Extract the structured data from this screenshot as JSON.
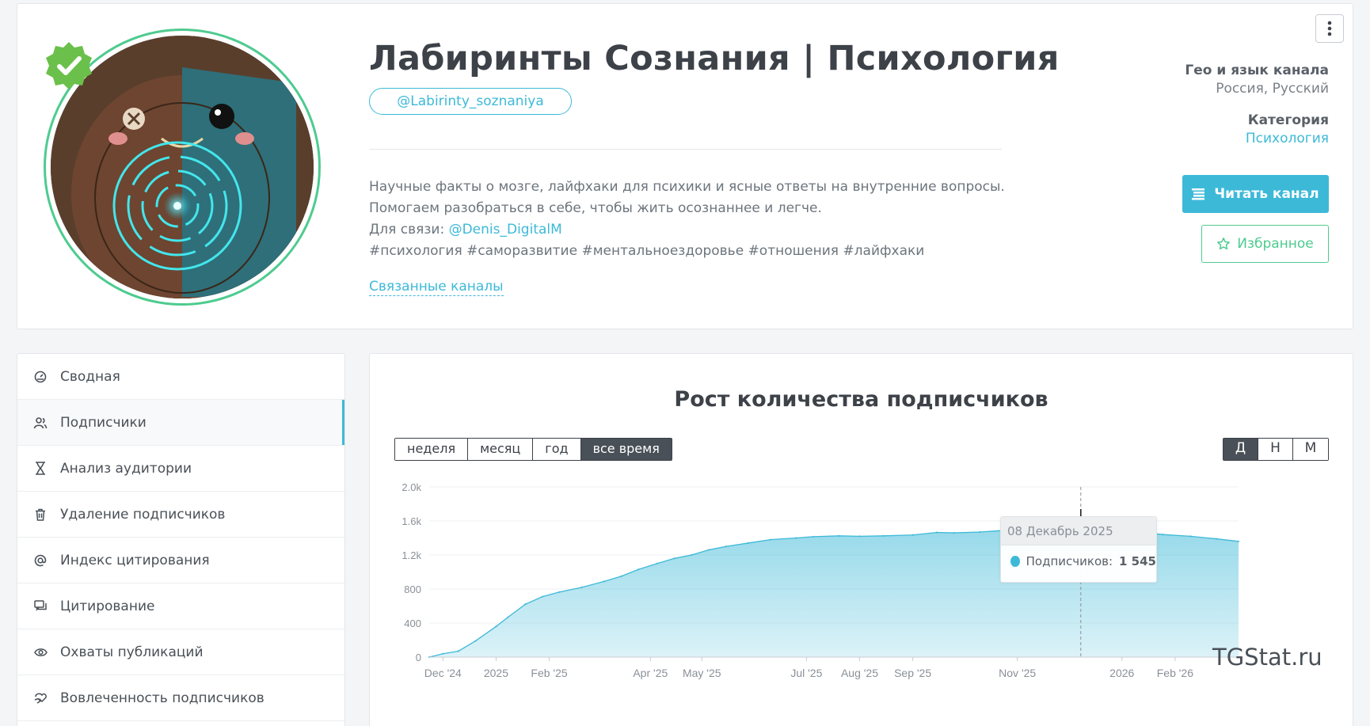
{
  "header": {
    "title": "Лабиринты Сознания | Психология",
    "username": "@Labirinty_soznaniya",
    "description": {
      "line1": "Научные факты о мозге, лайфхаки для психики и ясные ответы на внутренние вопросы.",
      "line2": "Помогаем разобраться в себе, чтобы жить осознаннее и легче.",
      "contact_label": "Для связи:",
      "contact_link": "@Denis_DigitalM",
      "hashtags": "#психология #саморазвитие #ментальноездоровье #отношения #лайфхаки"
    },
    "related_link": "Связанные каналы",
    "geo_label": "Гео и язык канала",
    "geo_value": "Россия, Русский",
    "category_label": "Категория",
    "category_value": "Психология",
    "read_button": "Читать канал",
    "favorite_button": "Избранное",
    "colors": {
      "accent": "#3db9d8",
      "green": "#4ecb8f"
    },
    "icons": [
      "verified-badge-icon",
      "more-vertical-icon",
      "list-icon",
      "star-icon"
    ]
  },
  "sidebar": {
    "items": [
      {
        "label": "Сводная",
        "icon": "dashboard-icon",
        "active": false
      },
      {
        "label": "Подписчики",
        "icon": "users-icon",
        "active": true
      },
      {
        "label": "Анализ аудитории",
        "icon": "hourglass-icon",
        "active": false
      },
      {
        "label": "Удаление подписчиков",
        "icon": "trash-icon",
        "active": false
      },
      {
        "label": "Индекс цитирования",
        "icon": "at-icon",
        "active": false
      },
      {
        "label": "Цитирование",
        "icon": "quote-icon",
        "active": false
      },
      {
        "label": "Охваты публикаций",
        "icon": "eye-icon",
        "active": false
      },
      {
        "label": "Вовлеченность подписчиков",
        "icon": "engagement-icon",
        "active": false
      }
    ]
  },
  "chart_panel": {
    "title": "Рост количества подписчиков",
    "periods": [
      "неделя",
      "месяц",
      "год",
      "все время"
    ],
    "active_period": "все время",
    "resolutions": [
      "Д",
      "Н",
      "М"
    ],
    "active_resolution": "Д",
    "tooltip": {
      "date": "08 Декабрь 2025",
      "label": "Подписчиков:",
      "value": "1 545"
    },
    "watermark": "TGStat.ru"
  },
  "chart_data": {
    "type": "area",
    "title": "Рост количества подписчиков",
    "xlabel": "",
    "ylabel": "",
    "ylim": [
      0,
      2000
    ],
    "y_ticks": [
      0,
      400,
      800,
      1200,
      1600,
      2000
    ],
    "y_tick_labels": [
      "0",
      "400",
      "800",
      "1.2k",
      "1.6k",
      "2.0k"
    ],
    "x_ticks": [
      {
        "date": "2024-12-01",
        "label": "Dec '24"
      },
      {
        "date": "2025-01-01",
        "label": "2025"
      },
      {
        "date": "2025-02-01",
        "label": "Feb '25"
      },
      {
        "date": "2025-04-01",
        "label": "Apr '25"
      },
      {
        "date": "2025-05-01",
        "label": "May '25"
      },
      {
        "date": "2025-07-01",
        "label": "Jul '25"
      },
      {
        "date": "2025-08-01",
        "label": "Aug '25"
      },
      {
        "date": "2025-09-01",
        "label": "Sep '25"
      },
      {
        "date": "2025-11-01",
        "label": "Nov '25"
      },
      {
        "date": "2026-01-01",
        "label": "2026"
      },
      {
        "date": "2026-02-01",
        "label": "Feb '26"
      }
    ],
    "x_range": [
      "2024-11-23",
      "2026-03-10"
    ],
    "grid": true,
    "color": "#3db9d8",
    "series": [
      {
        "points": [
          [
            "2024-11-23",
            0
          ],
          [
            "2024-12-01",
            40
          ],
          [
            "2024-12-10",
            70
          ],
          [
            "2024-12-20",
            190
          ],
          [
            "2025-01-01",
            360
          ],
          [
            "2025-01-08",
            470
          ],
          [
            "2025-01-18",
            620
          ],
          [
            "2025-01-28",
            710
          ],
          [
            "2025-02-07",
            765
          ],
          [
            "2025-02-20",
            820
          ],
          [
            "2025-03-05",
            890
          ],
          [
            "2025-03-15",
            950
          ],
          [
            "2025-03-25",
            1030
          ],
          [
            "2025-04-05",
            1100
          ],
          [
            "2025-04-15",
            1160
          ],
          [
            "2025-04-25",
            1200
          ],
          [
            "2025-05-05",
            1260
          ],
          [
            "2025-05-15",
            1300
          ],
          [
            "2025-05-28",
            1340
          ],
          [
            "2025-06-10",
            1380
          ],
          [
            "2025-06-25",
            1400
          ],
          [
            "2025-07-05",
            1415
          ],
          [
            "2025-07-20",
            1425
          ],
          [
            "2025-08-01",
            1420
          ],
          [
            "2025-08-15",
            1425
          ],
          [
            "2025-09-01",
            1435
          ],
          [
            "2025-09-15",
            1465
          ],
          [
            "2025-09-25",
            1460
          ],
          [
            "2025-10-10",
            1470
          ],
          [
            "2025-10-25",
            1490
          ],
          [
            "2025-11-10",
            1510
          ],
          [
            "2025-11-25",
            1530
          ],
          [
            "2025-12-08",
            1545
          ],
          [
            "2025-12-20",
            1550
          ],
          [
            "2026-01-01",
            1520
          ],
          [
            "2026-01-10",
            1470
          ],
          [
            "2026-01-25",
            1440
          ],
          [
            "2026-02-10",
            1420
          ],
          [
            "2026-02-25",
            1390
          ],
          [
            "2026-03-10",
            1360
          ]
        ]
      }
    ],
    "highlight": {
      "date": "2025-12-08",
      "value": 1545
    }
  }
}
